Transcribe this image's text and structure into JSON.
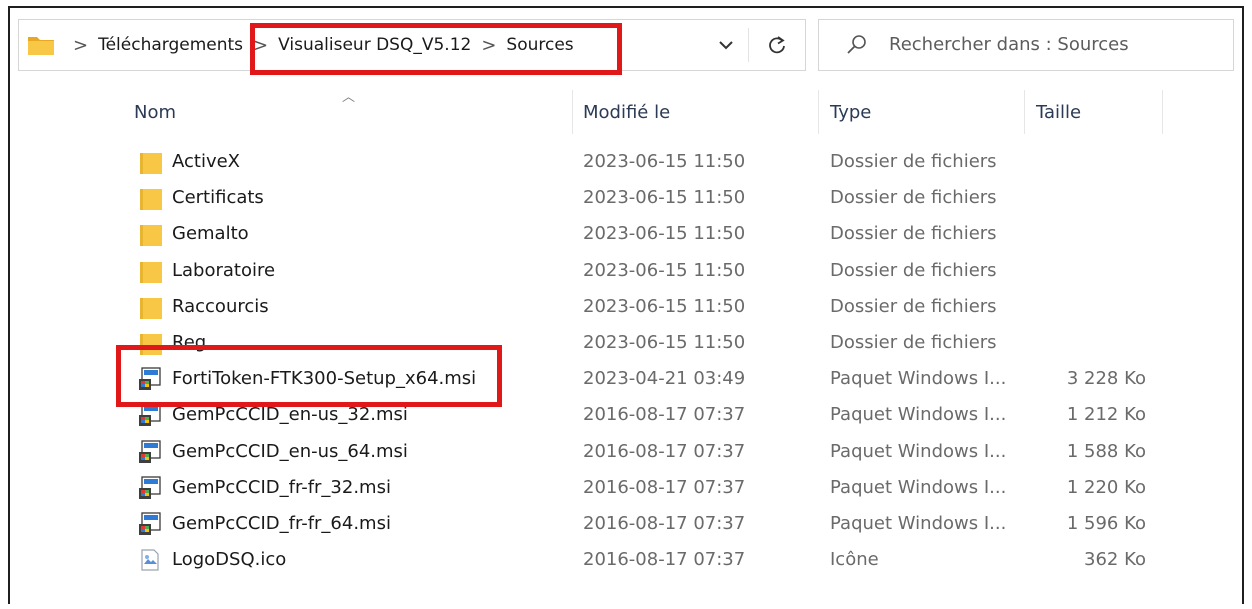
{
  "breadcrumb": {
    "items": [
      "Téléchargements",
      "Visualiseur DSQ_V5.12",
      "Sources"
    ],
    "separator": ">"
  },
  "search": {
    "placeholder": "Rechercher dans : Sources"
  },
  "columns": {
    "name": "Nom",
    "modified": "Modifié le",
    "type": "Type",
    "size": "Taille"
  },
  "files": [
    {
      "name": "ActiveX",
      "modified": "2023-06-15 11:50",
      "type": "Dossier de fichiers",
      "size": "",
      "icon": "folder-icon"
    },
    {
      "name": "Certificats",
      "modified": "2023-06-15 11:50",
      "type": "Dossier de fichiers",
      "size": "",
      "icon": "folder-icon"
    },
    {
      "name": "Gemalto",
      "modified": "2023-06-15 11:50",
      "type": "Dossier de fichiers",
      "size": "",
      "icon": "folder-icon"
    },
    {
      "name": "Laboratoire",
      "modified": "2023-06-15 11:50",
      "type": "Dossier de fichiers",
      "size": "",
      "icon": "folder-icon"
    },
    {
      "name": "Raccourcis",
      "modified": "2023-06-15 11:50",
      "type": "Dossier de fichiers",
      "size": "",
      "icon": "folder-icon"
    },
    {
      "name": "Reg",
      "modified": "2023-06-15 11:50",
      "type": "Dossier de fichiers",
      "size": "",
      "icon": "folder-icon"
    },
    {
      "name": "FortiToken-FTK300-Setup_x64.msi",
      "modified": "2023-04-21 03:49",
      "type": "Paquet Windows I...",
      "size": "3 228 Ko",
      "icon": "msi-installer-icon"
    },
    {
      "name": "GemPcCCID_en-us_32.msi",
      "modified": "2016-08-17 07:37",
      "type": "Paquet Windows I...",
      "size": "1 212 Ko",
      "icon": "msi-installer-icon"
    },
    {
      "name": "GemPcCCID_en-us_64.msi",
      "modified": "2016-08-17 07:37",
      "type": "Paquet Windows I...",
      "size": "1 588 Ko",
      "icon": "msi-installer-icon"
    },
    {
      "name": "GemPcCCID_fr-fr_32.msi",
      "modified": "2016-08-17 07:37",
      "type": "Paquet Windows I...",
      "size": "1 220 Ko",
      "icon": "msi-installer-icon"
    },
    {
      "name": "GemPcCCID_fr-fr_64.msi",
      "modified": "2016-08-17 07:37",
      "type": "Paquet Windows I...",
      "size": "1 596 Ko",
      "icon": "msi-installer-icon"
    },
    {
      "name": "LogoDSQ.ico",
      "modified": "2016-08-17 07:37",
      "type": "Icône",
      "size": "362 Ko",
      "icon": "ico-file-icon"
    }
  ],
  "colors": {
    "highlight": "#e0181a",
    "folder": "#f8c745",
    "header_text": "#2b3a55"
  }
}
